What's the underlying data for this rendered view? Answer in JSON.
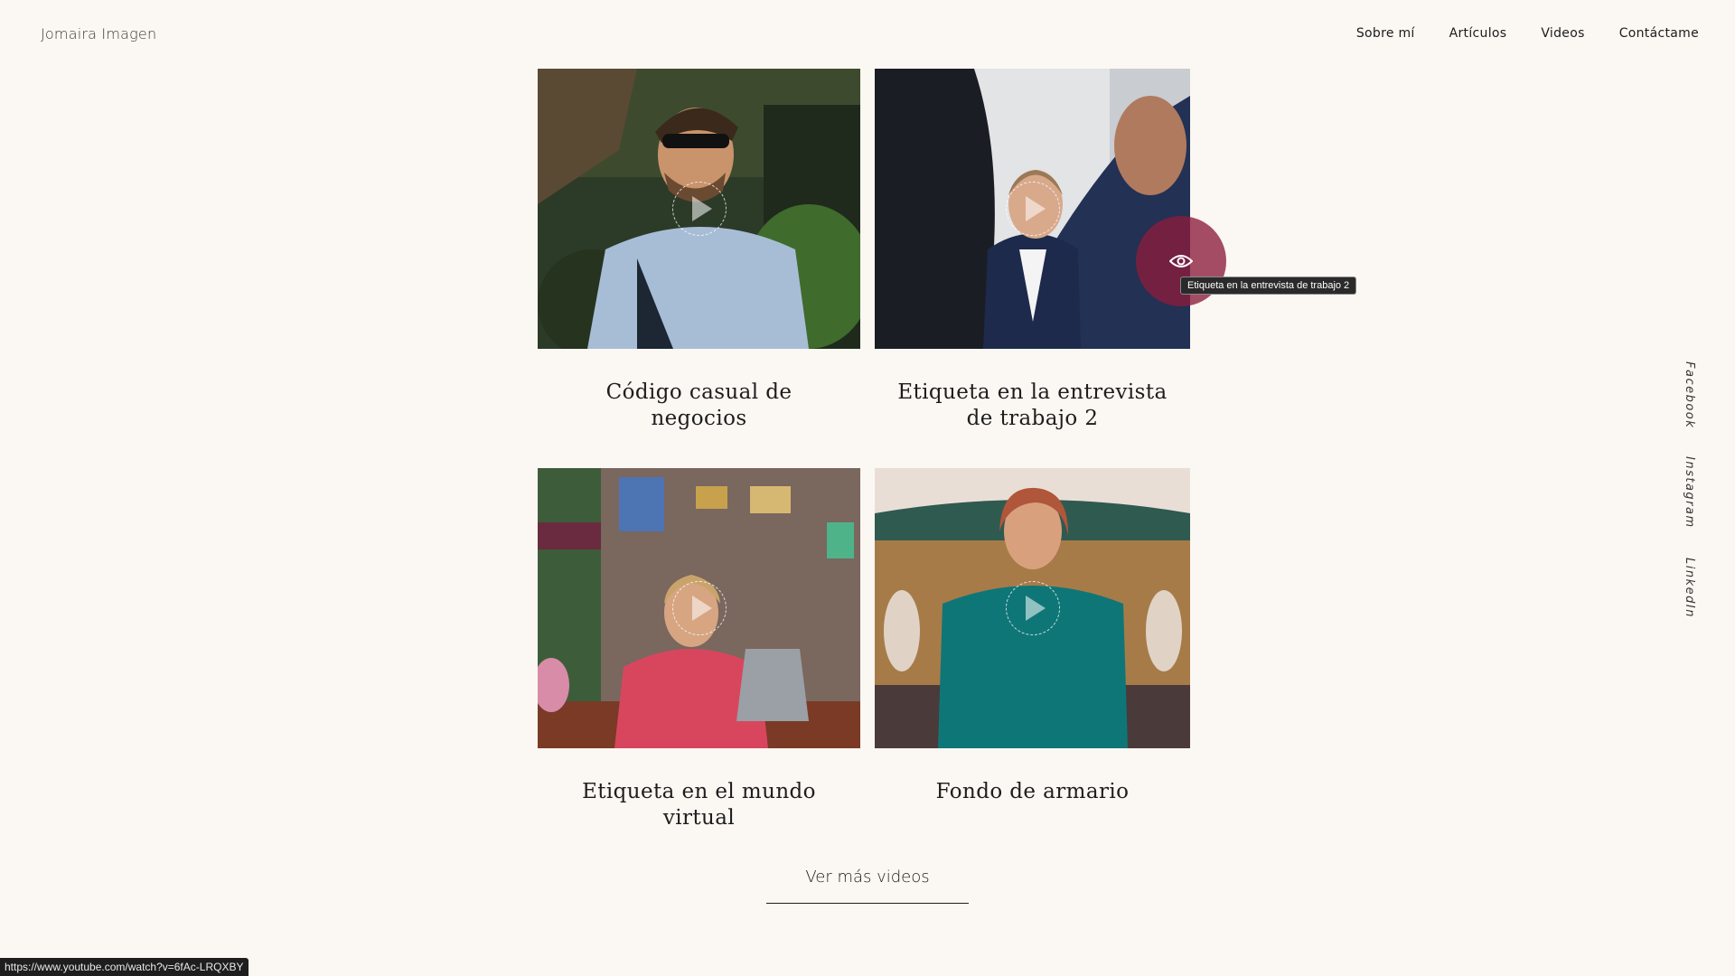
{
  "header": {
    "logo": "Jomaira Imagen",
    "nav": [
      "Sobre mí",
      "Artículos",
      "Videos",
      "Contáctame"
    ]
  },
  "videos": [
    {
      "title": "Código casual de negocios"
    },
    {
      "title": "Etiqueta en la entrevista de trabajo 2"
    },
    {
      "title": "Etiqueta en el mundo virtual"
    },
    {
      "title": "Fondo de armario"
    }
  ],
  "hover": {
    "tooltip": "Etiqueta en la entrevista de trabajo 2",
    "icon": "eye-icon",
    "color": "#8c1c3c"
  },
  "more_button": "Ver más videos",
  "social": [
    "Facebook",
    "Instagram",
    "LinkedIn"
  ],
  "status_url": "https://www.youtube.com/watch?v=6fAc-LRQXBY",
  "colors": {
    "background": "#fbf7f2",
    "accent": "#8c1c3c"
  }
}
